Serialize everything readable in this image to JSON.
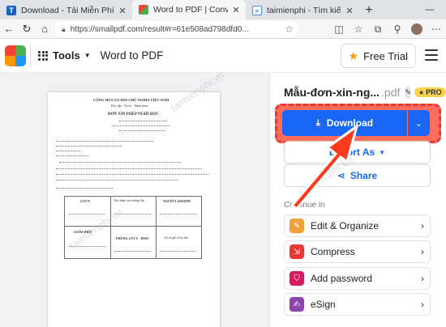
{
  "browser": {
    "tabs": [
      {
        "title": "Download - Tải Miễn Phí V",
        "favicon": "T",
        "color": "#1565c0",
        "active": false
      },
      {
        "title": "Word to PDF | Convert You",
        "favicon": "logo",
        "color": "#f44336",
        "active": true
      },
      {
        "title": "taimienphi - Tìm kiếm",
        "favicon": "search-icon",
        "color": "#4285f4",
        "active": false
      }
    ],
    "new_tab": "+",
    "url": "https://smallpdf.com/result#r=61e508ad798dfd0..."
  },
  "header": {
    "tools_label": "Tools",
    "page_title": "Word to PDF",
    "trial_label": "Free Trial"
  },
  "panel": {
    "file_name": "Mẫu-đơn-xin-ng...",
    "file_ext": ".pdf",
    "pro_badge": "PRO",
    "download_label": "Download",
    "export_label": "Export As",
    "share_label": "Share",
    "continue_label": "Continue in",
    "continue_items": [
      {
        "label": "Edit & Organize"
      },
      {
        "label": "Compress"
      },
      {
        "label": "Add password"
      },
      {
        "label": "eSign"
      }
    ]
  },
  "preview": {
    "watermark": "taimienphi.vn",
    "doc_lines": [
      "CỘNG HÒA XÃ HỘI CHỦ NGHĨA VIỆT NAM",
      "Độc lập - Tự do - Hạnh phúc",
      "ĐƠN XIN PHÉP NGHỈ HỌC",
      "GVCN",
      "Xác nhận của trưởng lớp",
      "NGƯỜI LÀM ĐƠN",
      "GIÁM HIỆU",
      "PHÒNG GVCT - HSSV",
      "Kí và ghi rõ họ tên"
    ]
  },
  "colors": {
    "accent": "#1a66f5",
    "highlight": "#e53935",
    "pro": "#f7d44c"
  }
}
